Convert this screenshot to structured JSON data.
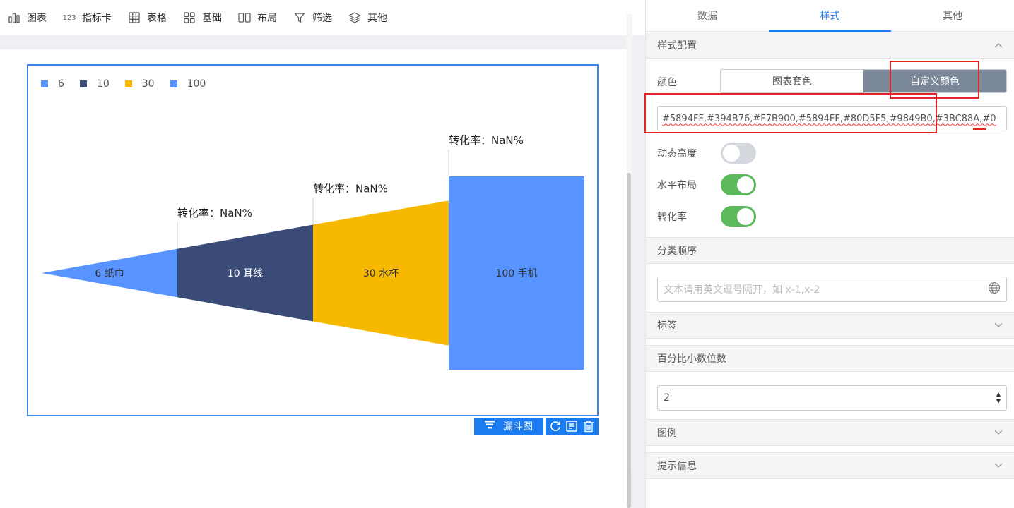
{
  "toolbar": {
    "items": [
      {
        "label": "图表",
        "icon": "bar-chart-icon"
      },
      {
        "label": "指标卡",
        "icon": "number-card-icon",
        "icon_text": "123"
      },
      {
        "label": "表格",
        "icon": "table-icon"
      },
      {
        "label": "基础",
        "icon": "grid-basic-icon"
      },
      {
        "label": "布局",
        "icon": "layout-icon"
      },
      {
        "label": "筛选",
        "icon": "filter-icon"
      },
      {
        "label": "其他",
        "icon": "layers-icon"
      }
    ]
  },
  "chart_data": {
    "type": "funnel",
    "orientation": "horizontal",
    "legend": [
      "6",
      "10",
      "30",
      "100"
    ],
    "categories": [
      "纸巾",
      "耳线",
      "水杯",
      "手机"
    ],
    "values": [
      6,
      10,
      30,
      100
    ],
    "segment_labels": [
      "6 纸巾",
      "10 耳线",
      "30 水杯",
      "100 手机"
    ],
    "colors": [
      "#5894FF",
      "#394B76",
      "#F7B900",
      "#5894FF"
    ],
    "conversion_labels": [
      "转化率：NaN%",
      "转化率：NaN%",
      "转化率：NaN%"
    ]
  },
  "chart_footer": {
    "type_label": "漏斗图",
    "icons": [
      "refresh-icon",
      "edit-icon",
      "delete-icon"
    ]
  },
  "panel": {
    "tabs": [
      "数据",
      "样式",
      "其他"
    ],
    "active_tab": "样式",
    "style_section": {
      "title": "样式配置",
      "color_label": "颜色",
      "color_options": [
        "图表套色",
        "自定义颜色"
      ],
      "selected_color_option": "自定义颜色",
      "custom_colors_value": "#5894FF,#394B76,#F7B900,#5894FF,#80D5F5,#9849B0,#3BC88A,#0",
      "dynamic_height_label": "动态高度",
      "dynamic_height_on": false,
      "horizontal_layout_label": "水平布局",
      "horizontal_layout_on": true,
      "conversion_rate_label": "转化率",
      "conversion_rate_on": true
    },
    "category_order": {
      "title": "分类顺序",
      "placeholder": "文本请用英文逗号隔开，如 x-1,x-2"
    },
    "label_section": {
      "title": "标签"
    },
    "decimal_section": {
      "title": "百分比小数位数",
      "value": "2"
    },
    "legend_section": {
      "title": "图例"
    },
    "tooltip_section": {
      "title": "提示信息"
    }
  }
}
